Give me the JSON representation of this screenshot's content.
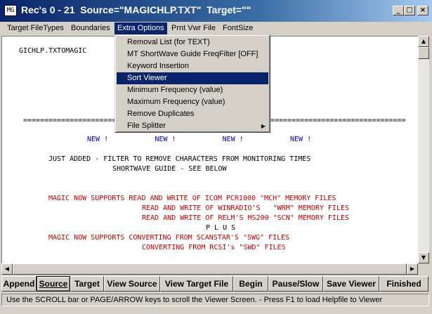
{
  "window": {
    "title": "Rec's 0 - 21  Source=\"MAGICHLP.TXT\"  Target=\"\"",
    "icon_label": "MG",
    "controls": {
      "minimize": "_",
      "maximize": "□",
      "close": "×"
    }
  },
  "menubar": {
    "items": [
      {
        "label": "Target FileTypes"
      },
      {
        "label": "Boundaries"
      },
      {
        "label": "Extra Options"
      },
      {
        "label": "Prnt Vwr File"
      },
      {
        "label": "FontSize"
      }
    ]
  },
  "dropdown": {
    "items": [
      {
        "label": "Removal List (for TEXT)"
      },
      {
        "label": "MT ShortWave Guide FreqFilter [OFF]"
      },
      {
        "label": "Keyword Insertion"
      },
      {
        "label": "Sort Viewer"
      },
      {
        "label": "Minimum Frequency (value)"
      },
      {
        "label": "Maximum Frequency (value)"
      },
      {
        "label": "Remove Duplicates"
      },
      {
        "label": "File Splitter",
        "submenu_arrow": "▶"
      }
    ]
  },
  "viewer": {
    "lines": {
      "header": "GICHLP.TXTOMAGIC",
      "sep_left": "=============================",
      "sep_right": "================================",
      "new_row": "NEW !           NEW !           NEW !           NEW !",
      "just_added": "JUST ADDED - FILTER TO REMOVE CHARACTERS FROM MONITORING TIMES",
      "sw_guide": "SHORTWAVE GUIDE - SEE BELOW",
      "magic1": "MAGIC NOW SUPPORTS READ AND WRITE OF ICOM PCR1000 \"MCH\" MEMORY FILES",
      "winradio": "READ AND WRITE OF WINRADIO'S   \"WRM\" MEMORY FILES",
      "relm": "READ AND WRITE OF RELM'S MS200 \"SCN\" MEMORY FILES",
      "plus": "P L U S",
      "magic2": "MAGIC NOW SUPPORTS CONVERTING FROM SCANSTAR'S \"SWG\" FILES",
      "rcsi": "CONVERTING FROM RCSI's \"SWD\" FILES"
    }
  },
  "scrollbars": {
    "up": "▲",
    "down": "▼",
    "left": "◀",
    "right": "▶"
  },
  "buttons": [
    {
      "label": "Append"
    },
    {
      "label": "Source"
    },
    {
      "label": "Target"
    },
    {
      "label": "View Source"
    },
    {
      "label": "View Target File"
    },
    {
      "label": "Begin"
    },
    {
      "label": "Pause/Slow"
    },
    {
      "label": "Save Viewer"
    },
    {
      "label": "Finished"
    }
  ],
  "status": "Use the SCROLL bar or PAGE/ARROW keys to scroll the Viewer Screen.  - Press F1 to load Helpfile to Viewer",
  "colors": {
    "title_start": "#0a246a",
    "title_end": "#a6caf0",
    "menu_highlight": "#0a246a",
    "red_text": "#c00000",
    "blue_text": "#0000c0"
  }
}
